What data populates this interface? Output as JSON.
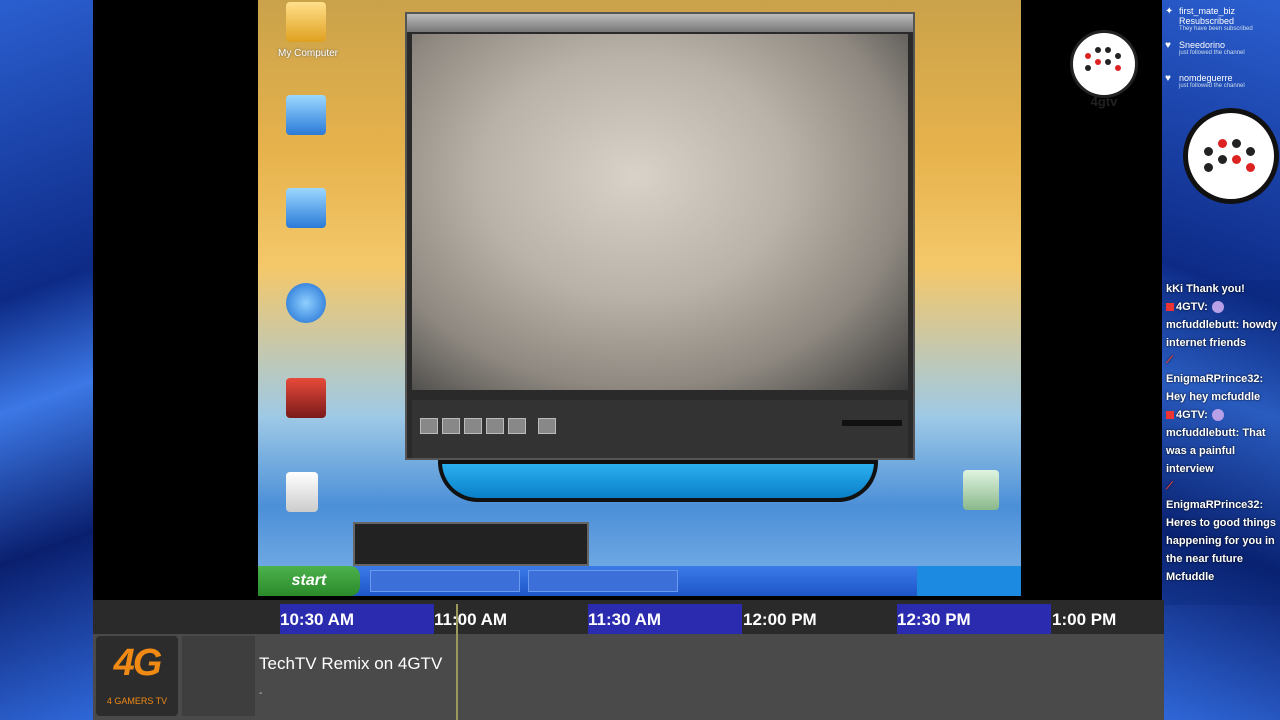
{
  "stream": {
    "player_bug_label": "4gtv"
  },
  "desktop": {
    "icon_label": "My Computer",
    "start_label": "start"
  },
  "alerts": [
    {
      "name": "first_mate_biz Resubscribed",
      "sub": "They have been subscribed"
    },
    {
      "name": "Sneedorino",
      "sub": "just followed the channel"
    },
    {
      "name": "nomdeguerre",
      "sub": "just followed the channel"
    }
  ],
  "chat": {
    "lines": [
      "kKi Thank you!",
      "4GTV:",
      "mcfuddlebutt: howdy internet friends",
      "EnigmaRPrince32: Hey hey mcfuddle",
      "4GTV:",
      "mcfuddlebutt: That was a painful interview",
      "EnigmaRPrince32: Heres to good things happening for you in the near future Mcfuddle"
    ]
  },
  "schedule": {
    "times": [
      "10:30 AM",
      "11:00 AM",
      "11:30 AM",
      "12:00 PM",
      "12:30 PM",
      "1:00 PM"
    ],
    "logo_main": "4G",
    "logo_sub": "4 GAMERS TV",
    "program_title": "TechTV Remix on 4GTV",
    "program_sub": "-"
  },
  "colors": {
    "slot_accent": "#2b2bb0",
    "logo_orange": "#f08a14"
  }
}
